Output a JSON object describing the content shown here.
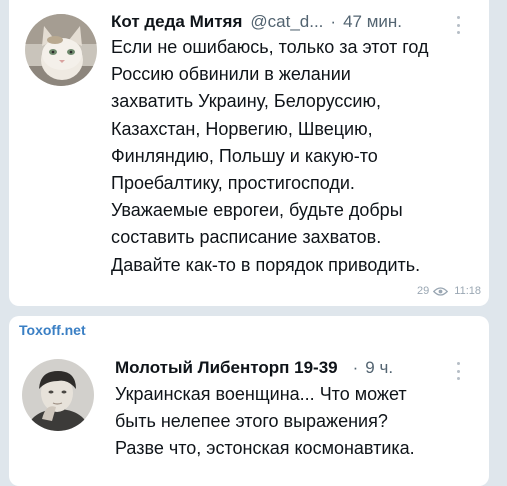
{
  "post1": {
    "author": "Кот деда Митяя",
    "handle": "@cat_d...",
    "separator": "·",
    "time": "47 мин.",
    "lines": [
      "Если не ошибаюсь, только за этот год",
      "Россию обвинили в желании",
      "захватить Украину, Белоруссию,",
      "Казахстан, Норвегию, Швецию,",
      "Финляндию, Польшу и какую-то",
      "Проебалтику, простигосподи.",
      "Уважаемые еврогеи, будьте добры",
      "составить расписание захватов.",
      "Давайте как-то в порядок приводить."
    ],
    "views": "29",
    "posted_at": "11:18",
    "icon": "eye-icon"
  },
  "source_label": "Toxoff.net",
  "post2": {
    "author": "Молотый Либенторп 19-39",
    "separator": "·",
    "time": "9 ч.",
    "lines": [
      "Украинская военщина... Что может",
      "быть нелепее этого выражения?",
      "Разве что, эстонская космонавтика."
    ]
  },
  "colors": {
    "background": "#dfe6ec",
    "card": "#ffffff",
    "text": "#0f1419",
    "muted": "#536471",
    "link": "#3a7fc4"
  }
}
